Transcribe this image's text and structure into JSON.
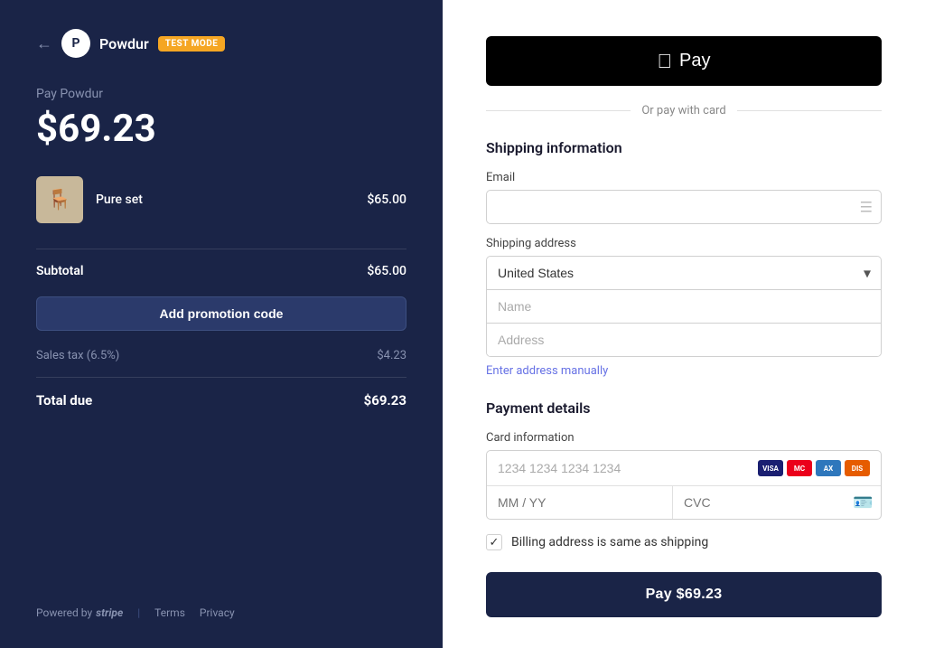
{
  "left": {
    "back_label": "←",
    "logo_text": "P",
    "brand": "Powdur",
    "test_mode": "TEST MODE",
    "pay_label": "Pay Powdur",
    "amount": "$69.23",
    "product": {
      "name": "Pure set",
      "price": "$65.00",
      "emoji": "🪑"
    },
    "subtotal_label": "Subtotal",
    "subtotal_value": "$65.00",
    "promo_label": "Add promotion code",
    "tax_label": "Sales tax (6.5%)",
    "tax_value": "$4.23",
    "total_label": "Total due",
    "total_value": "$69.23",
    "powered_by": "Powered by",
    "stripe_label": "stripe",
    "terms_label": "Terms",
    "privacy_label": "Privacy"
  },
  "right": {
    "apple_pay_label": "Pay",
    "divider_text": "Or pay with card",
    "shipping_title": "Shipping information",
    "email_label": "Email",
    "email_placeholder": "",
    "shipping_address_label": "Shipping address",
    "country_value": "United States",
    "name_placeholder": "Name",
    "address_placeholder": "Address",
    "address_manual_link": "Enter address manually",
    "payment_title": "Payment details",
    "card_info_label": "Card information",
    "card_placeholder": "1234 1234 1234 1234",
    "expiry_placeholder": "MM / YY",
    "cvc_placeholder": "CVC",
    "billing_label": "Billing address is same as shipping",
    "pay_btn_label": "Pay $69.23"
  }
}
